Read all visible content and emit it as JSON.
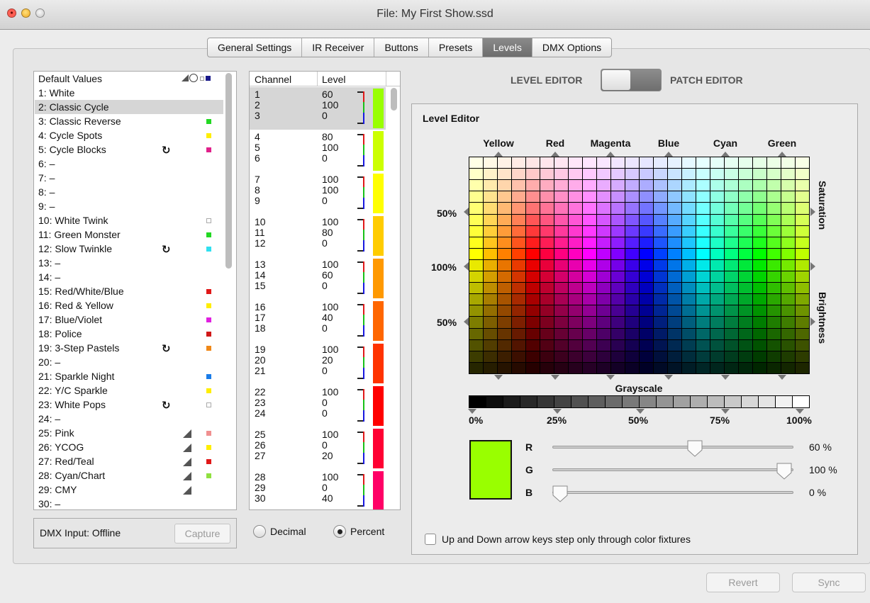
{
  "window": {
    "title": "File: My First Show.ssd"
  },
  "tabs": [
    {
      "label": "General Settings"
    },
    {
      "label": "IR Receiver"
    },
    {
      "label": "Buttons"
    },
    {
      "label": "Presets"
    },
    {
      "label": "Levels",
      "active": true
    },
    {
      "label": "DMX Options"
    }
  ],
  "presets": {
    "header": "Default Values",
    "selected_index": 1,
    "items": [
      {
        "label": "1:  White",
        "icon": "",
        "color": ""
      },
      {
        "label": "2:  Classic Cycle",
        "icon": "",
        "color": ""
      },
      {
        "label": "3:  Classic Reverse",
        "icon": "",
        "color": "#22d822"
      },
      {
        "label": "4:  Cycle Spots",
        "icon": "",
        "color": "#ffee00"
      },
      {
        "label": "5:  Cycle Blocks",
        "icon": "cycle",
        "color": "#e0208a"
      },
      {
        "label": "6:  –",
        "icon": "",
        "color": ""
      },
      {
        "label": "7:  –",
        "icon": "",
        "color": ""
      },
      {
        "label": "8:  –",
        "icon": "",
        "color": ""
      },
      {
        "label": "9:  –",
        "icon": "",
        "color": ""
      },
      {
        "label": "10: White Twink",
        "icon": "",
        "color": "empty"
      },
      {
        "label": "11: Green Monster",
        "icon": "",
        "color": "#22d822"
      },
      {
        "label": "12: Slow Twinkle",
        "icon": "cycle",
        "color": "#30e0f0"
      },
      {
        "label": "13: –",
        "icon": "",
        "color": ""
      },
      {
        "label": "14: –",
        "icon": "",
        "color": ""
      },
      {
        "label": "15: Red/White/Blue",
        "icon": "",
        "color": "#e01818"
      },
      {
        "label": "16: Red & Yellow",
        "icon": "",
        "color": "#ffee00"
      },
      {
        "label": "17: Blue/Violet",
        "icon": "",
        "color": "#e020e0"
      },
      {
        "label": "18: Police",
        "icon": "",
        "color": "#d01818"
      },
      {
        "label": "19: 3-Step Pastels",
        "icon": "cycle",
        "color": "#f08818"
      },
      {
        "label": "20: –",
        "icon": "",
        "color": ""
      },
      {
        "label": "21: Sparkle Night",
        "icon": "",
        "color": "#1a7ce8"
      },
      {
        "label": "22: Y/C Sparkle",
        "icon": "",
        "color": "#ffee00"
      },
      {
        "label": "23: White Pops",
        "icon": "cycle",
        "color": "empty"
      },
      {
        "label": "24: –",
        "icon": "",
        "color": ""
      },
      {
        "label": "25: Pink",
        "icon": "ramp",
        "color": "#f09090"
      },
      {
        "label": "26: YCOG",
        "icon": "ramp",
        "color": "#ffee00"
      },
      {
        "label": "27: Red/Teal",
        "icon": "ramp",
        "color": "#e01818"
      },
      {
        "label": "28: Cyan/Chart",
        "icon": "ramp",
        "color": "#90e040"
      },
      {
        "label": "29: CMY",
        "icon": "ramp",
        "color": ""
      },
      {
        "label": "30: –",
        "icon": "",
        "color": ""
      }
    ]
  },
  "dmx": {
    "status": "DMX Input: Offline",
    "capture_label": "Capture"
  },
  "channels": {
    "headers": {
      "channel": "Channel",
      "level": "Level"
    },
    "groups": [
      {
        "levels": [
          "60",
          "100",
          "0"
        ],
        "color": "#99ff00"
      },
      {
        "levels": [
          "80",
          "100",
          "0"
        ],
        "color": "#ccff00"
      },
      {
        "levels": [
          "100",
          "100",
          "0"
        ],
        "color": "#ffff00"
      },
      {
        "levels": [
          "100",
          "80",
          "0"
        ],
        "color": "#ffcc00"
      },
      {
        "levels": [
          "100",
          "60",
          "0"
        ],
        "color": "#ff9900"
      },
      {
        "levels": [
          "100",
          "40",
          "0"
        ],
        "color": "#ff6600"
      },
      {
        "levels": [
          "100",
          "20",
          "0"
        ],
        "color": "#ff3300"
      },
      {
        "levels": [
          "100",
          "0",
          "0"
        ],
        "color": "#ff0000"
      },
      {
        "levels": [
          "100",
          "0",
          "20"
        ],
        "color": "#ff0033"
      },
      {
        "levels": [
          "100",
          "0",
          "40"
        ],
        "color": "#ff0066"
      }
    ]
  },
  "format": {
    "decimal": "Decimal",
    "percent": "Percent",
    "selected": "percent"
  },
  "mode": {
    "left": "LEVEL EDITOR",
    "right": "PATCH EDITOR",
    "active": "level"
  },
  "editor": {
    "title": "Level Editor",
    "hues": [
      "Yellow",
      "Red",
      "Magenta",
      "Blue",
      "Cyan",
      "Green"
    ],
    "saturation_label": "Saturation",
    "brightness_label": "Brightness",
    "pct_top": "50%",
    "pct_mid": "100%",
    "pct_low": "50%",
    "grayscale_label": "Grayscale",
    "gray_ticks": [
      "0%",
      "25%",
      "50%",
      "75%",
      "100%"
    ],
    "preview_color": "#99ff00",
    "sliders": [
      {
        "label": "R",
        "value": 60,
        "text": "60 %"
      },
      {
        "label": "G",
        "value": 100,
        "text": "100 %"
      },
      {
        "label": "B",
        "value": 0,
        "text": "0 %"
      }
    ],
    "checkbox_label": "Up and Down arrow keys step only through color fixtures",
    "checkbox_checked": false
  },
  "footer": {
    "revert": "Revert",
    "sync": "Sync"
  }
}
